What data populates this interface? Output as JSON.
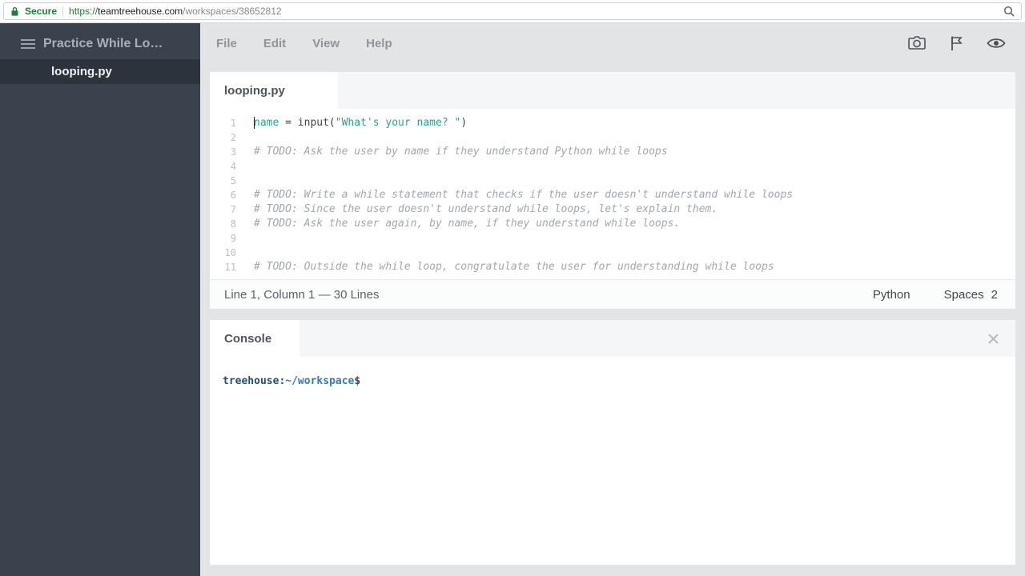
{
  "browser": {
    "security_label": "Secure",
    "url": {
      "scheme": "https://",
      "domain": "teamtreehouse.com",
      "path": "/workspaces/38652812"
    }
  },
  "sidebar": {
    "workspace_title": "Practice While Lo…",
    "files": [
      {
        "name": "looping.py",
        "selected": true
      }
    ]
  },
  "menubar": {
    "items": [
      "File",
      "Edit",
      "View",
      "Help"
    ]
  },
  "icons": {
    "lock": "lock-icon",
    "zoom": "magnifier-icon",
    "menu": "hamburger-icon",
    "camera": "camera-icon",
    "flag": "flag-icon",
    "preview": "eye-icon",
    "close": "close-icon"
  },
  "editor": {
    "tab_label": "looping.py",
    "lines": [
      {
        "n": "1",
        "cursor": true,
        "tokens": [
          {
            "c": "ident",
            "t": "name"
          },
          {
            "c": "plain",
            "t": " = input("
          },
          {
            "c": "string",
            "t": "\"What's your name? \""
          },
          {
            "c": "plain",
            "t": ")"
          }
        ]
      },
      {
        "n": "2",
        "tokens": []
      },
      {
        "n": "3",
        "tokens": [
          {
            "c": "comment",
            "t": "# TODO: Ask the user by name if they understand Python while loops"
          }
        ]
      },
      {
        "n": "4",
        "tokens": []
      },
      {
        "n": "5",
        "tokens": []
      },
      {
        "n": "6",
        "tokens": [
          {
            "c": "comment",
            "t": "# TODO: Write a while statement that checks if the user doesn't understand while loops"
          }
        ]
      },
      {
        "n": "7",
        "tokens": [
          {
            "c": "comment",
            "t": "# TODO: Since the user doesn't understand while loops, let's explain them."
          }
        ]
      },
      {
        "n": "8",
        "tokens": [
          {
            "c": "comment",
            "t": "# TODO: Ask the user again, by name, if they understand while loops."
          }
        ]
      },
      {
        "n": "9",
        "tokens": []
      },
      {
        "n": "10",
        "tokens": []
      },
      {
        "n": "11",
        "tokens": [
          {
            "c": "comment",
            "t": "# TODO: Outside the while loop, congratulate the user for understanding while loops"
          }
        ]
      }
    ],
    "status": {
      "left": "Line 1, Column 1 — 30 Lines",
      "language": "Python",
      "spaces_label": "Spaces",
      "spaces_value": "2"
    }
  },
  "console": {
    "tab_label": "Console",
    "prompt": {
      "user": "treehouse",
      "separator": ":",
      "path": "~/workspace",
      "symbol": "$"
    }
  },
  "colors": {
    "accent_teal": "#2aa38d",
    "sidebar_bg": "#3a424d",
    "secure_green": "#188038",
    "prompt_user": "#1f4e79",
    "prompt_path": "#2e7cb8"
  }
}
